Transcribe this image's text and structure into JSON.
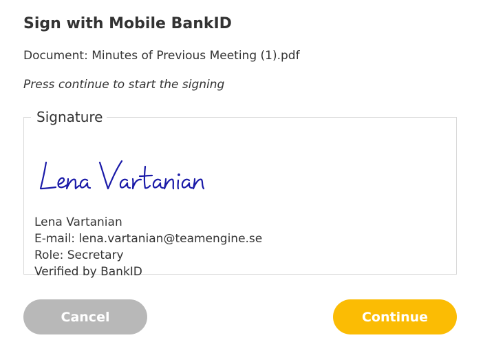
{
  "dialog": {
    "title": "Sign with Mobile BankID",
    "document_line": "Document: Minutes of Previous Meeting (1).pdf",
    "instruction": "Press continue to start the signing"
  },
  "signature": {
    "legend": "Signature",
    "handwritten_name": "Lena Vartanian",
    "ink_color": "#1a1aa8",
    "details": {
      "name": "Lena Vartanian",
      "email": "E-mail: lena.vartanian@teamengine.se",
      "role": "Role: Secretary",
      "verified": "Verified by BankID"
    }
  },
  "buttons": {
    "cancel_label": "Cancel",
    "continue_label": "Continue",
    "cancel_color": "#b8b8b8",
    "continue_color": "#fbbc04"
  }
}
